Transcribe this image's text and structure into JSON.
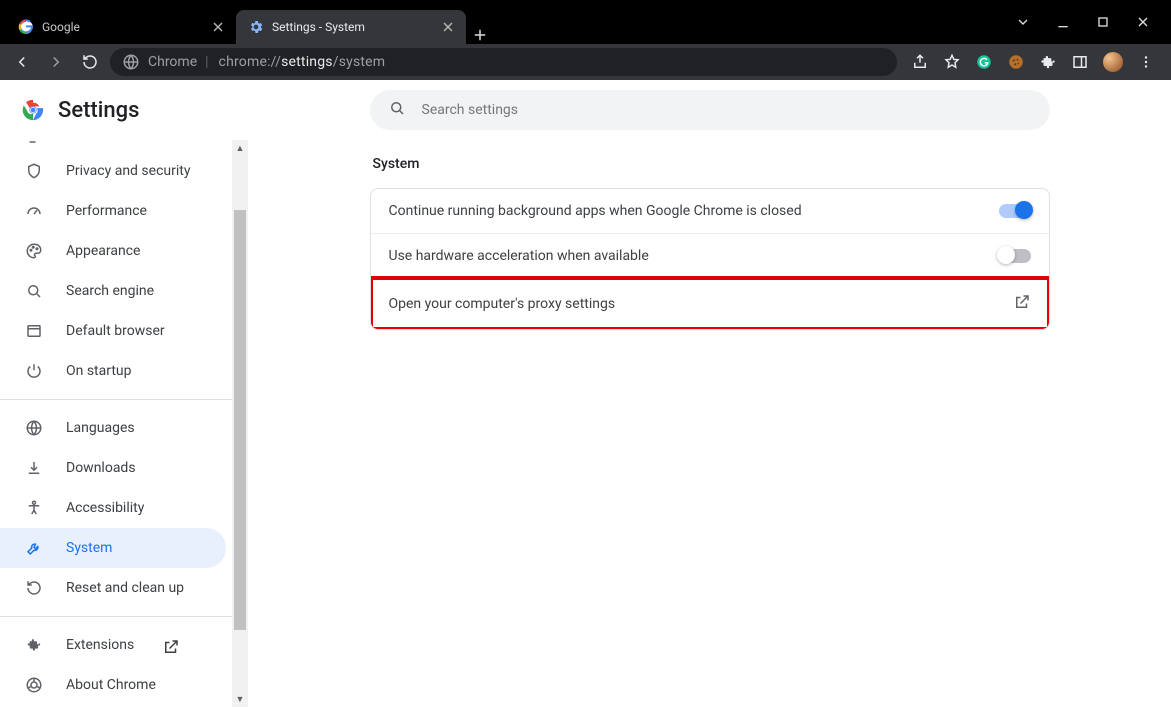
{
  "window": {
    "tabs": [
      {
        "title": "Google",
        "active": false
      },
      {
        "title": "Settings - System",
        "active": true
      }
    ]
  },
  "address": {
    "label": "Chrome",
    "url_prefix": "chrome://",
    "url_bold": "settings",
    "url_suffix": "/system"
  },
  "brand": "Settings",
  "search": {
    "placeholder": "Search settings"
  },
  "sidebar": {
    "groups": [
      [
        {
          "icon": "shield-icon",
          "label": "Privacy and security"
        },
        {
          "icon": "speed-icon",
          "label": "Performance"
        },
        {
          "icon": "palette-icon",
          "label": "Appearance"
        },
        {
          "icon": "search-icon",
          "label": "Search engine"
        },
        {
          "icon": "browser-icon",
          "label": "Default browser"
        },
        {
          "icon": "power-icon",
          "label": "On startup"
        }
      ],
      [
        {
          "icon": "globe-icon",
          "label": "Languages"
        },
        {
          "icon": "download-icon",
          "label": "Downloads"
        },
        {
          "icon": "accessibility-icon",
          "label": "Accessibility"
        },
        {
          "icon": "wrench-icon",
          "label": "System",
          "selected": true
        },
        {
          "icon": "restore-icon",
          "label": "Reset and clean up"
        }
      ],
      [
        {
          "icon": "extension-icon",
          "label": "Extensions",
          "external": true
        },
        {
          "icon": "chrome-icon",
          "label": "About Chrome"
        }
      ]
    ]
  },
  "section": {
    "title": "System",
    "rows": [
      {
        "label": "Continue running background apps when Google Chrome is closed",
        "toggle": true
      },
      {
        "label": "Use hardware acceleration when available",
        "toggle": false
      },
      {
        "label": "Open your computer's proxy settings",
        "launch": true,
        "highlight": true
      }
    ]
  }
}
